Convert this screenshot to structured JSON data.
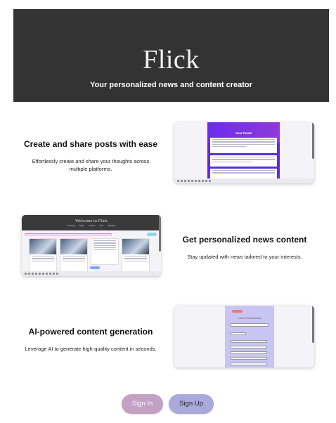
{
  "hero": {
    "title": "Flick",
    "tagline": "Your personalized news and content creator"
  },
  "features": [
    {
      "title": "Create and share posts with ease",
      "description": "Effortlessly create and share your thoughts across multiple platforms.",
      "preview": {
        "heading": "Your Posts"
      }
    },
    {
      "title": "Get personalized news content",
      "description": "Stay updated with news tailored to your interests.",
      "preview": {
        "heading": "Welcome to Flick",
        "nav": "Trending News   Content Tool   Translate"
      }
    },
    {
      "title": "AI-powered content generation",
      "description": "Leverage AI to generate high-quality content in seconds.",
      "preview": {
        "heading": "Content Tool Generator"
      }
    }
  ],
  "actions": {
    "sign_in": "Sign In",
    "sign_up": "Sign Up"
  },
  "colors": {
    "hero_bg": "#333333",
    "sign_in_bg": "#c4a0c4",
    "sign_up_bg": "#a9a9dc",
    "posts_accent": "#5b2fd6",
    "generator_accent": "#c9c5f2"
  }
}
